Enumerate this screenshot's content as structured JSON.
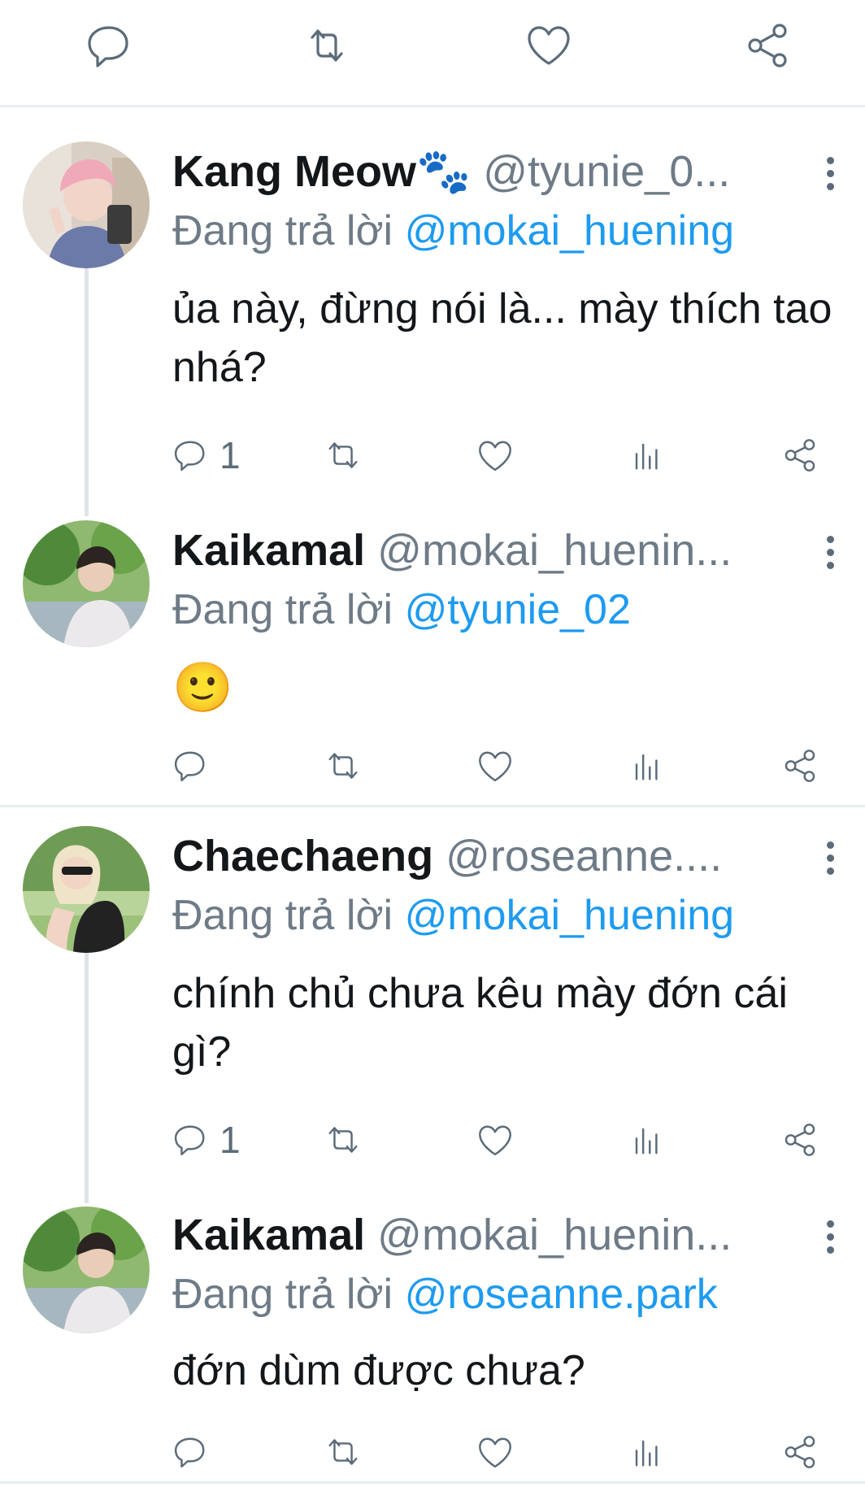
{
  "top_actions": [
    "reply-icon",
    "retweet-icon",
    "like-icon",
    "share-icon"
  ],
  "tweets": [
    {
      "name": "Kang Meow🐾",
      "handle": "@tyunie_0...",
      "replying_prefix": "Đang trả lời",
      "replying_to": "@mokai_huening",
      "text": "ủa này, đừng nói là... mày thích tao nhá?",
      "reply_count": "1"
    },
    {
      "name": "Kaikamal",
      "handle": "@mokai_huenin...",
      "replying_prefix": "Đang trả lời",
      "replying_to": "@tyunie_02",
      "text": "🙂",
      "reply_count": ""
    },
    {
      "name": "Chaechaeng",
      "handle": "@roseanne....",
      "replying_prefix": "Đang trả lời",
      "replying_to": "@mokai_huening",
      "text": "chính chủ chưa kêu mày đớn cái gì?",
      "reply_count": "1"
    },
    {
      "name": "Kaikamal",
      "handle": "@mokai_huenin...",
      "replying_prefix": "Đang trả lời",
      "replying_to": "@roseanne.park",
      "text": "đớn dùm được chưa?",
      "reply_count": ""
    }
  ],
  "colors": {
    "mention": "#1d9bf0",
    "muted": "#6e7b87",
    "icon": "#5b6b79",
    "divider": "#e9edf0"
  }
}
